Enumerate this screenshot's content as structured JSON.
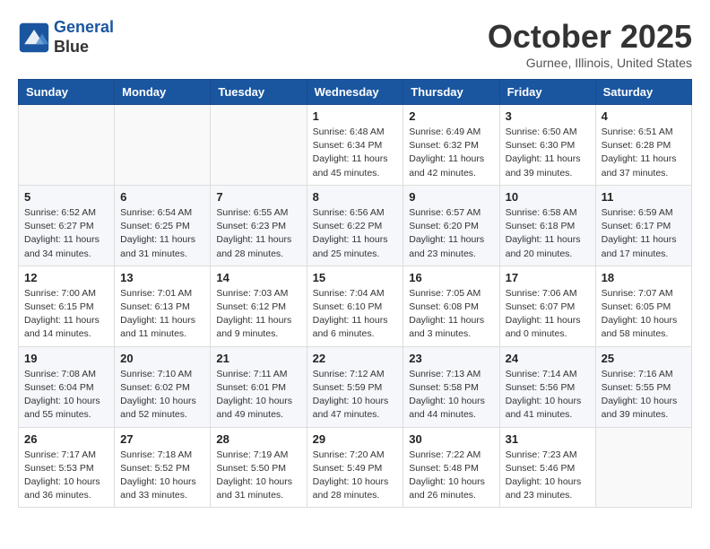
{
  "header": {
    "logo_line1": "General",
    "logo_line2": "Blue",
    "month": "October 2025",
    "location": "Gurnee, Illinois, United States"
  },
  "weekdays": [
    "Sunday",
    "Monday",
    "Tuesday",
    "Wednesday",
    "Thursday",
    "Friday",
    "Saturday"
  ],
  "weeks": [
    [
      {
        "day": "",
        "info": ""
      },
      {
        "day": "",
        "info": ""
      },
      {
        "day": "",
        "info": ""
      },
      {
        "day": "1",
        "info": "Sunrise: 6:48 AM\nSunset: 6:34 PM\nDaylight: 11 hours\nand 45 minutes."
      },
      {
        "day": "2",
        "info": "Sunrise: 6:49 AM\nSunset: 6:32 PM\nDaylight: 11 hours\nand 42 minutes."
      },
      {
        "day": "3",
        "info": "Sunrise: 6:50 AM\nSunset: 6:30 PM\nDaylight: 11 hours\nand 39 minutes."
      },
      {
        "day": "4",
        "info": "Sunrise: 6:51 AM\nSunset: 6:28 PM\nDaylight: 11 hours\nand 37 minutes."
      }
    ],
    [
      {
        "day": "5",
        "info": "Sunrise: 6:52 AM\nSunset: 6:27 PM\nDaylight: 11 hours\nand 34 minutes."
      },
      {
        "day": "6",
        "info": "Sunrise: 6:54 AM\nSunset: 6:25 PM\nDaylight: 11 hours\nand 31 minutes."
      },
      {
        "day": "7",
        "info": "Sunrise: 6:55 AM\nSunset: 6:23 PM\nDaylight: 11 hours\nand 28 minutes."
      },
      {
        "day": "8",
        "info": "Sunrise: 6:56 AM\nSunset: 6:22 PM\nDaylight: 11 hours\nand 25 minutes."
      },
      {
        "day": "9",
        "info": "Sunrise: 6:57 AM\nSunset: 6:20 PM\nDaylight: 11 hours\nand 23 minutes."
      },
      {
        "day": "10",
        "info": "Sunrise: 6:58 AM\nSunset: 6:18 PM\nDaylight: 11 hours\nand 20 minutes."
      },
      {
        "day": "11",
        "info": "Sunrise: 6:59 AM\nSunset: 6:17 PM\nDaylight: 11 hours\nand 17 minutes."
      }
    ],
    [
      {
        "day": "12",
        "info": "Sunrise: 7:00 AM\nSunset: 6:15 PM\nDaylight: 11 hours\nand 14 minutes."
      },
      {
        "day": "13",
        "info": "Sunrise: 7:01 AM\nSunset: 6:13 PM\nDaylight: 11 hours\nand 11 minutes."
      },
      {
        "day": "14",
        "info": "Sunrise: 7:03 AM\nSunset: 6:12 PM\nDaylight: 11 hours\nand 9 minutes."
      },
      {
        "day": "15",
        "info": "Sunrise: 7:04 AM\nSunset: 6:10 PM\nDaylight: 11 hours\nand 6 minutes."
      },
      {
        "day": "16",
        "info": "Sunrise: 7:05 AM\nSunset: 6:08 PM\nDaylight: 11 hours\nand 3 minutes."
      },
      {
        "day": "17",
        "info": "Sunrise: 7:06 AM\nSunset: 6:07 PM\nDaylight: 11 hours\nand 0 minutes."
      },
      {
        "day": "18",
        "info": "Sunrise: 7:07 AM\nSunset: 6:05 PM\nDaylight: 10 hours\nand 58 minutes."
      }
    ],
    [
      {
        "day": "19",
        "info": "Sunrise: 7:08 AM\nSunset: 6:04 PM\nDaylight: 10 hours\nand 55 minutes."
      },
      {
        "day": "20",
        "info": "Sunrise: 7:10 AM\nSunset: 6:02 PM\nDaylight: 10 hours\nand 52 minutes."
      },
      {
        "day": "21",
        "info": "Sunrise: 7:11 AM\nSunset: 6:01 PM\nDaylight: 10 hours\nand 49 minutes."
      },
      {
        "day": "22",
        "info": "Sunrise: 7:12 AM\nSunset: 5:59 PM\nDaylight: 10 hours\nand 47 minutes."
      },
      {
        "day": "23",
        "info": "Sunrise: 7:13 AM\nSunset: 5:58 PM\nDaylight: 10 hours\nand 44 minutes."
      },
      {
        "day": "24",
        "info": "Sunrise: 7:14 AM\nSunset: 5:56 PM\nDaylight: 10 hours\nand 41 minutes."
      },
      {
        "day": "25",
        "info": "Sunrise: 7:16 AM\nSunset: 5:55 PM\nDaylight: 10 hours\nand 39 minutes."
      }
    ],
    [
      {
        "day": "26",
        "info": "Sunrise: 7:17 AM\nSunset: 5:53 PM\nDaylight: 10 hours\nand 36 minutes."
      },
      {
        "day": "27",
        "info": "Sunrise: 7:18 AM\nSunset: 5:52 PM\nDaylight: 10 hours\nand 33 minutes."
      },
      {
        "day": "28",
        "info": "Sunrise: 7:19 AM\nSunset: 5:50 PM\nDaylight: 10 hours\nand 31 minutes."
      },
      {
        "day": "29",
        "info": "Sunrise: 7:20 AM\nSunset: 5:49 PM\nDaylight: 10 hours\nand 28 minutes."
      },
      {
        "day": "30",
        "info": "Sunrise: 7:22 AM\nSunset: 5:48 PM\nDaylight: 10 hours\nand 26 minutes."
      },
      {
        "day": "31",
        "info": "Sunrise: 7:23 AM\nSunset: 5:46 PM\nDaylight: 10 hours\nand 23 minutes."
      },
      {
        "day": "",
        "info": ""
      }
    ]
  ]
}
